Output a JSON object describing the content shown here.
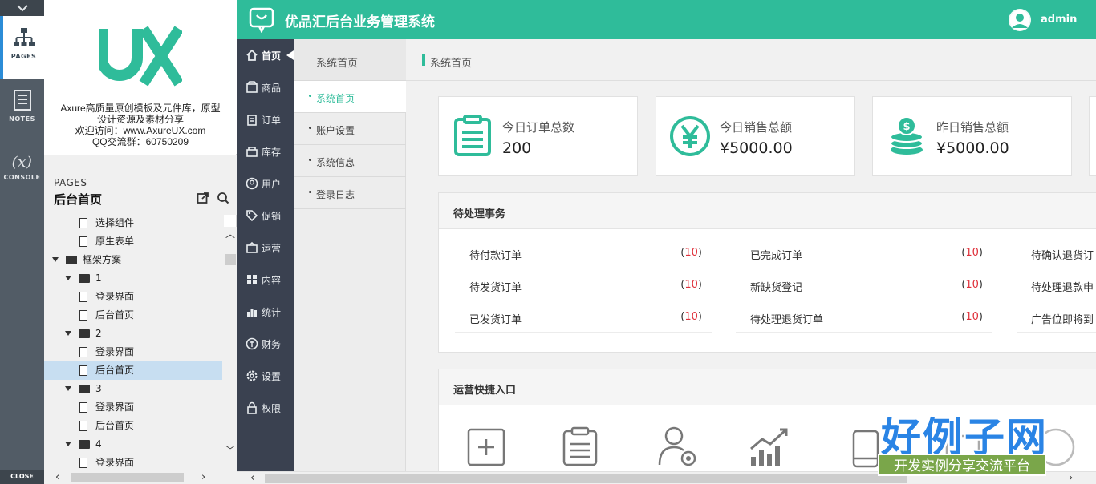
{
  "axure": {
    "tabs": [
      {
        "label": "PAGES",
        "icon": "sitemap-icon"
      },
      {
        "label": "NOTES",
        "icon": "notes-icon"
      },
      {
        "label": "CONSOLE",
        "icon": "variable-icon"
      }
    ],
    "close_label": "CLOSE",
    "console_glyph": "(x)"
  },
  "brand": {
    "logo_text": "UX",
    "lines": [
      "Axure高质量原创模板及元件库，原型",
      "设计资源及素材分享",
      "欢迎访问：www.AxureUX.com",
      "QQ交流群：60750209"
    ]
  },
  "pages_panel": {
    "label": "PAGES",
    "current": "后台首页",
    "tree": [
      {
        "label": "选择组件",
        "type": "page",
        "level": 2
      },
      {
        "label": "原生表单",
        "type": "page",
        "level": 2
      },
      {
        "label": "框架方案",
        "type": "folder",
        "level": 0
      },
      {
        "label": "1",
        "type": "folder",
        "level": 1
      },
      {
        "label": "登录界面",
        "type": "page",
        "level": 2
      },
      {
        "label": "后台首页",
        "type": "page",
        "level": 2
      },
      {
        "label": "2",
        "type": "folder",
        "level": 1
      },
      {
        "label": "登录界面",
        "type": "page",
        "level": 2
      },
      {
        "label": "后台首页",
        "type": "page",
        "level": 2,
        "selected": true
      },
      {
        "label": "3",
        "type": "folder",
        "level": 1
      },
      {
        "label": "登录界面",
        "type": "page",
        "level": 2
      },
      {
        "label": "后台首页",
        "type": "page",
        "level": 2
      },
      {
        "label": "4",
        "type": "folder",
        "level": 1
      },
      {
        "label": "登录界面",
        "type": "page",
        "level": 2
      }
    ]
  },
  "header": {
    "title": "优品汇后台业务管理系统",
    "user": "admin"
  },
  "nav": [
    {
      "label": "首页",
      "icon": "home-icon",
      "active": true
    },
    {
      "label": "商品",
      "icon": "box-icon"
    },
    {
      "label": "订单",
      "icon": "clipboard-icon"
    },
    {
      "label": "库存",
      "icon": "stock-icon"
    },
    {
      "label": "用户",
      "icon": "user-icon"
    },
    {
      "label": "促销",
      "icon": "tag-icon"
    },
    {
      "label": "运营",
      "icon": "operation-icon"
    },
    {
      "label": "内容",
      "icon": "grid-icon"
    },
    {
      "label": "统计",
      "icon": "bar-chart-icon"
    },
    {
      "label": "财务",
      "icon": "finance-icon"
    },
    {
      "label": "设置",
      "icon": "gear-icon"
    },
    {
      "label": "权限",
      "icon": "lock-icon"
    }
  ],
  "subnav": {
    "title": "系统首页",
    "items": [
      {
        "label": "系统首页",
        "active": true
      },
      {
        "label": "账户设置"
      },
      {
        "label": "系统信息"
      },
      {
        "label": "登录日志"
      }
    ]
  },
  "breadcrumb": "系统首页",
  "stats": [
    {
      "label": "今日订单总数",
      "value": "200",
      "icon": "clipboard-icon"
    },
    {
      "label": "今日销售总额",
      "value": "¥5000.00",
      "icon": "yen-circle-icon"
    },
    {
      "label": "昨日销售总额",
      "value": "¥5000.00",
      "icon": "coins-icon"
    }
  ],
  "pending": {
    "title": "待处理事务",
    "columns": [
      [
        {
          "label": "待付款订单",
          "count": "10"
        },
        {
          "label": "待发货订单",
          "count": "10"
        },
        {
          "label": "已发货订单",
          "count": "10"
        }
      ],
      [
        {
          "label": "已完成订单",
          "count": "10"
        },
        {
          "label": "新缺货登记",
          "count": "10"
        },
        {
          "label": "待处理退货订单",
          "count": "10"
        }
      ],
      [
        {
          "label": "待确认退货订",
          "count": ""
        },
        {
          "label": "待处理退款申",
          "count": ""
        },
        {
          "label": "广告位即将到",
          "count": ""
        }
      ]
    ]
  },
  "quick": {
    "title": "运营快捷入口",
    "icons": [
      "add-icon",
      "clipboard-icon",
      "user-gear-icon",
      "trend-chart-icon",
      "mobile-icon",
      "ad-icon",
      "star-icon"
    ]
  },
  "watermark": {
    "big": "好例子网",
    "small": "开发实例分享交流平台"
  },
  "colors": {
    "brand": "#2fbc9a",
    "nav_bg": "#3a4150",
    "count_red": "#e0313b"
  }
}
